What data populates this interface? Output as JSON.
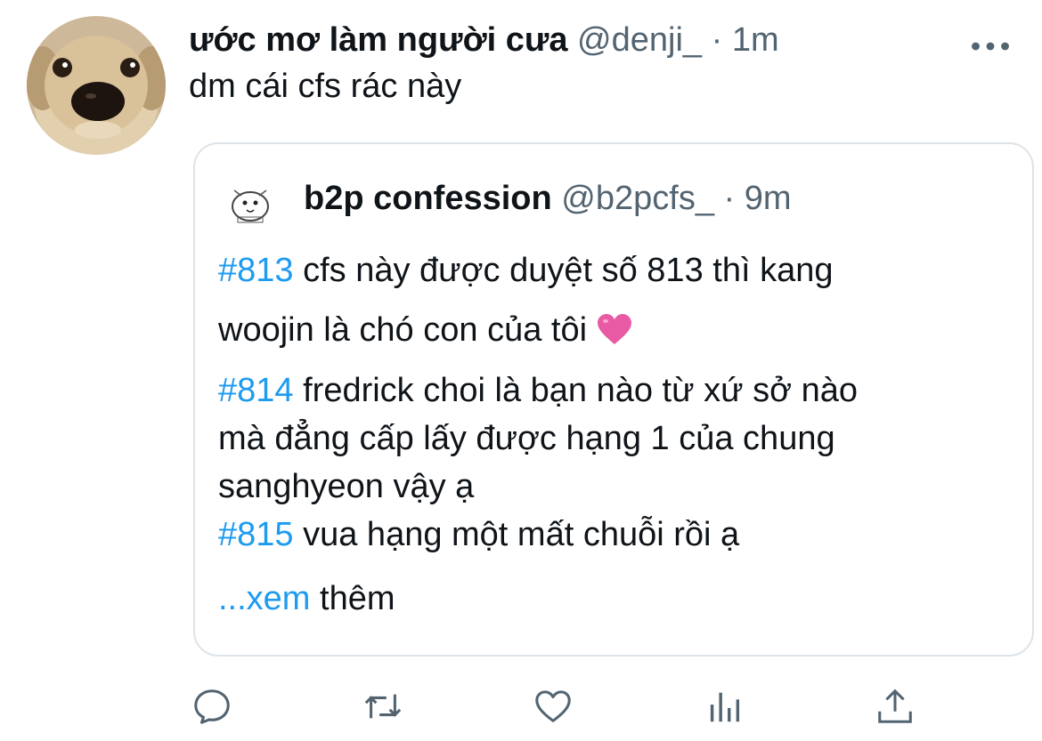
{
  "tweet": {
    "author_name": "ước mơ làm người cưa",
    "author_handle": "@denji_",
    "separator": "·",
    "time": "1m",
    "text": "dm cái cfs rác này",
    "more_icon": "ellipsis-icon",
    "avatar_icon": "dog-avatar"
  },
  "quote": {
    "author_name": "b2p confession",
    "author_handle": "@b2pcfs_",
    "separator": "·",
    "time": "9m",
    "lines": [
      {
        "hash": "#813",
        "text": " cfs này được duyệt số 813 thì kang"
      },
      {
        "hash": "",
        "text": "woojin là chó con của tôi "
      },
      {
        "hash": "#814",
        "text": " fredrick choi là bạn nào từ xứ sở nào"
      },
      {
        "hash": "",
        "text": "mà đẳng cấp lấy được hạng 1 của chung"
      },
      {
        "hash": "",
        "text": "sanghyeon vậy ạ"
      },
      {
        "hash": "#815",
        "text": " vua hạng một mất chuỗi rồi ạ"
      }
    ],
    "emoji": "pink-heart-emoji",
    "see_more_prefix": "...xem",
    "see_more_suffix": " thêm"
  },
  "actions": [
    {
      "name": "reply",
      "icon": "reply-icon"
    },
    {
      "name": "retweet",
      "icon": "retweet-icon"
    },
    {
      "name": "like",
      "icon": "heart-icon"
    },
    {
      "name": "analytics",
      "icon": "analytics-icon"
    },
    {
      "name": "share",
      "icon": "share-icon"
    }
  ],
  "colors": {
    "accent": "#1d9bf0",
    "muted": "#536471",
    "border": "#dde3e8",
    "emoji": "#e85aa4"
  }
}
